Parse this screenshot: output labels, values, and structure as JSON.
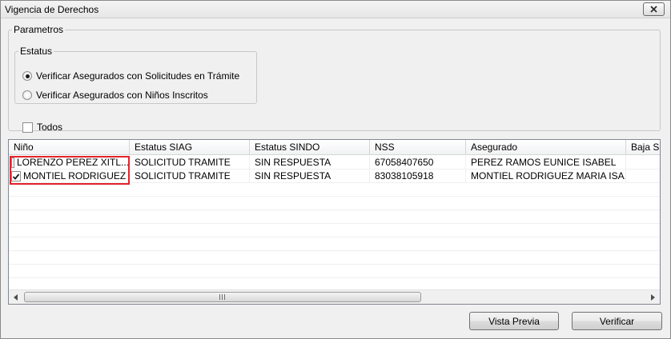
{
  "window": {
    "title": "Vigencia de Derechos"
  },
  "parametros": {
    "label": "Parametros",
    "estatus": {
      "label": "Estatus",
      "options": [
        {
          "label": "Verificar Asegurados con Solicitudes en Trámite",
          "selected": true
        },
        {
          "label": "Verificar Asegurados con Niños Inscritos",
          "selected": false
        }
      ]
    },
    "todos": {
      "label": "Todos",
      "checked": false
    }
  },
  "grid": {
    "columns": [
      "Niño",
      "Estatus SIAG",
      "Estatus SINDO",
      "NSS",
      "Asegurado",
      "Baja SII"
    ],
    "rows": [
      {
        "checked": false,
        "nino": "LORENZO PEREZ XITL...",
        "estatus_siag": "SOLICITUD TRAMITE",
        "estatus_sindo": "SIN RESPUESTA",
        "nss": "67058407650",
        "asegurado": "PEREZ RAMOS EUNICE ISABEL"
      },
      {
        "checked": true,
        "nino": "MONTIEL RODRIGUEZ ...",
        "estatus_siag": "SOLICITUD TRAMITE",
        "estatus_sindo": "SIN RESPUESTA",
        "nss": "83038105918",
        "asegurado": "MONTIEL RODRIGUEZ MARIA ISA..."
      }
    ],
    "highlight_color": "#e0242b"
  },
  "buttons": {
    "vista_previa": "Vista Previa",
    "verificar": "Verificar"
  },
  "icons": {
    "close": "close-icon",
    "check": "check-icon",
    "left": "chevron-left-icon",
    "right": "chevron-right-icon"
  }
}
